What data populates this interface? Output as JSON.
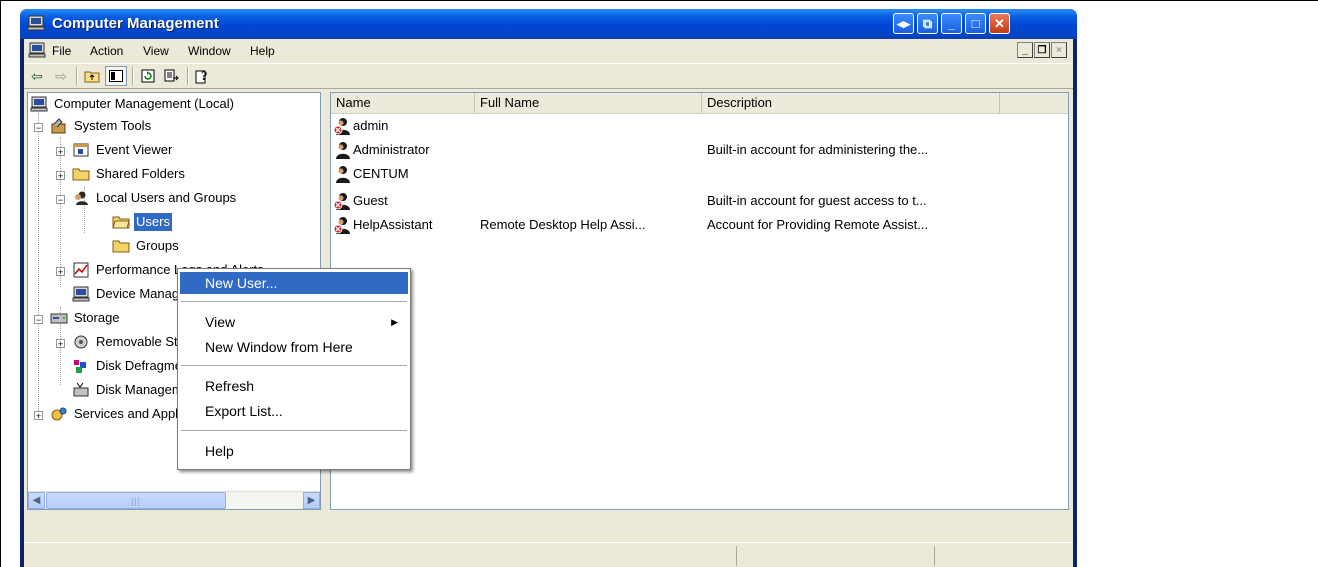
{
  "window": {
    "title": "Computer Management"
  },
  "menubar": {
    "items": [
      "File",
      "Action",
      "View",
      "Window",
      "Help"
    ]
  },
  "toolbar": {
    "buttons": [
      "back-arrow-icon",
      "forward-arrow-icon",
      "up-folder-icon",
      "show-hide-tree-icon",
      "refresh-icon",
      "export-list-icon",
      "help-icon"
    ]
  },
  "tree": {
    "root": "Computer Management (Local)",
    "system_tools": "System Tools",
    "event_viewer": "Event Viewer",
    "shared_folders": "Shared Folders",
    "local_users": "Local Users and Groups",
    "users": "Users",
    "groups": "Groups",
    "performance": "Performance Logs and Alerts",
    "device_manager": "Device Manager",
    "storage": "Storage",
    "removable": "Removable Storage",
    "defrag": "Disk Defragmenter",
    "disk_mgmt": "Disk Management",
    "services": "Services and Applications"
  },
  "list": {
    "columns": [
      "Name",
      "Full Name",
      "Description"
    ],
    "rows": [
      {
        "name": "admin",
        "full_name": "",
        "description": "",
        "disabled": true
      },
      {
        "name": "Administrator",
        "full_name": "",
        "description": "Built-in account for administering the...",
        "disabled": false
      },
      {
        "name": "CENTUM",
        "full_name": "",
        "description": "",
        "disabled": false
      },
      {
        "name": "Guest",
        "full_name": "",
        "description": "Built-in account for guest access to t...",
        "disabled": true
      },
      {
        "name": "HelpAssistant",
        "full_name": "Remote Desktop Help Assi...",
        "description": "Account for Providing Remote Assist...",
        "disabled": true
      }
    ]
  },
  "context_menu": {
    "new_user": "New User...",
    "view": "View",
    "new_window": "New Window from Here",
    "refresh": "Refresh",
    "export": "Export List...",
    "help": "Help"
  },
  "colors": {
    "selection": "#316ac5",
    "titlebar": "#0046d5",
    "face": "#ece9d8"
  }
}
